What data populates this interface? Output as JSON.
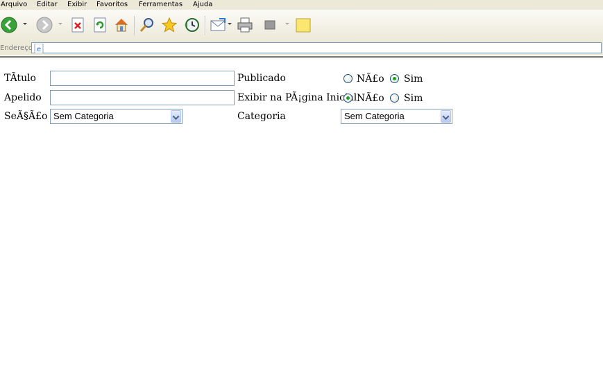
{
  "menu": [
    "Arquivo",
    "Editar",
    "Exibir",
    "Favoritos",
    "Ferramentas",
    "Ajuda"
  ],
  "toolbar": {
    "icons": [
      "back-icon",
      "forward-icon",
      "stop-icon",
      "refresh-icon",
      "home-icon",
      "search-icon",
      "favorites-icon",
      "history-icon",
      "mail-icon",
      "print-icon",
      "edit-icon",
      "notes-icon"
    ]
  },
  "address": {
    "label": "Endereço",
    "value": ""
  },
  "form": {
    "title_label": "TÃtulo",
    "title_value": "",
    "alias_label": "Apelido",
    "alias_value": "",
    "section_label": "SeÃ§Ã£o",
    "section_value": "Sem Categoria",
    "published_label": "Publicado",
    "published_no": "NÃ£o",
    "published_yes": "Sim",
    "published_selected": "yes",
    "frontpage_label": "Exibir na PÃ¡gina Inicial",
    "frontpage_no": "NÃ£o",
    "frontpage_yes": "Sim",
    "frontpage_selected": "no",
    "category_label": "Categoria",
    "category_value": "Sem Categoria"
  },
  "colors": {
    "chrome": "#ece9d8",
    "field_border": "#7f9db9",
    "radio_dot": "#21a121"
  }
}
